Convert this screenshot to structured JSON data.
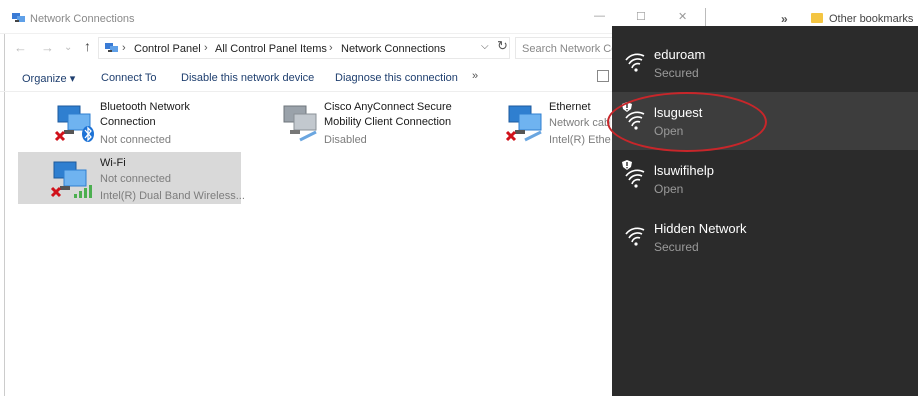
{
  "window": {
    "title": "Network Connections",
    "minimize": "—",
    "maximize": "☐",
    "close": "✕"
  },
  "browser_fragment": {
    "chevron": "»",
    "bookmarks_label": "Other bookmarks"
  },
  "address": {
    "back": "←",
    "forward": "→",
    "recent": "⌄",
    "up": "↑",
    "separator": "›",
    "crumbs": [
      "Control Panel",
      "All Control Panel Items",
      "Network Connections"
    ],
    "dropdown": "⌵",
    "refresh": "↻",
    "search_placeholder": "Search Network Co"
  },
  "commands": {
    "organize": "Organize ▾",
    "connect_to": "Connect To",
    "disable": "Disable this network device",
    "diagnose": "Diagnose this connection",
    "more": "»"
  },
  "connections": [
    {
      "name_line1": "Bluetooth Network",
      "name_line2": "Connection",
      "status": "Not connected",
      "adapter": "",
      "icon": "bluetooth-adapter-icon",
      "x_mark": true
    },
    {
      "name_line1": "Cisco AnyConnect Secure",
      "name_line2": "Mobility Client Connection",
      "status": "Disabled",
      "adapter": "",
      "icon": "vpn-adapter-icon",
      "x_mark": false
    },
    {
      "name_line1": "Ethernet",
      "name_line2": "",
      "status": "Network cabl",
      "adapter": "Intel(R) Ethern",
      "icon": "ethernet-adapter-icon",
      "x_mark": true
    },
    {
      "name_line1": "Wi-Fi",
      "name_line2": "",
      "status": "Not connected",
      "adapter": "Intel(R) Dual Band Wireless...",
      "icon": "wifi-adapter-icon",
      "x_mark": true
    }
  ],
  "wifi_networks": [
    {
      "name": "eduroam",
      "status": "Secured",
      "warning": false
    },
    {
      "name": "lsuguest",
      "status": "Open",
      "warning": true
    },
    {
      "name": "lsuwifihelp",
      "status": "Open",
      "warning": true
    },
    {
      "name": "Hidden Network",
      "status": "Secured",
      "warning": false
    }
  ],
  "colors": {
    "flyout_bg": "#2b2b2b",
    "hover_row": "#3d3d3d",
    "highlight_ring": "#c8262a",
    "x_mark": "#d0121b",
    "selected_item": "#d9d9d9"
  }
}
